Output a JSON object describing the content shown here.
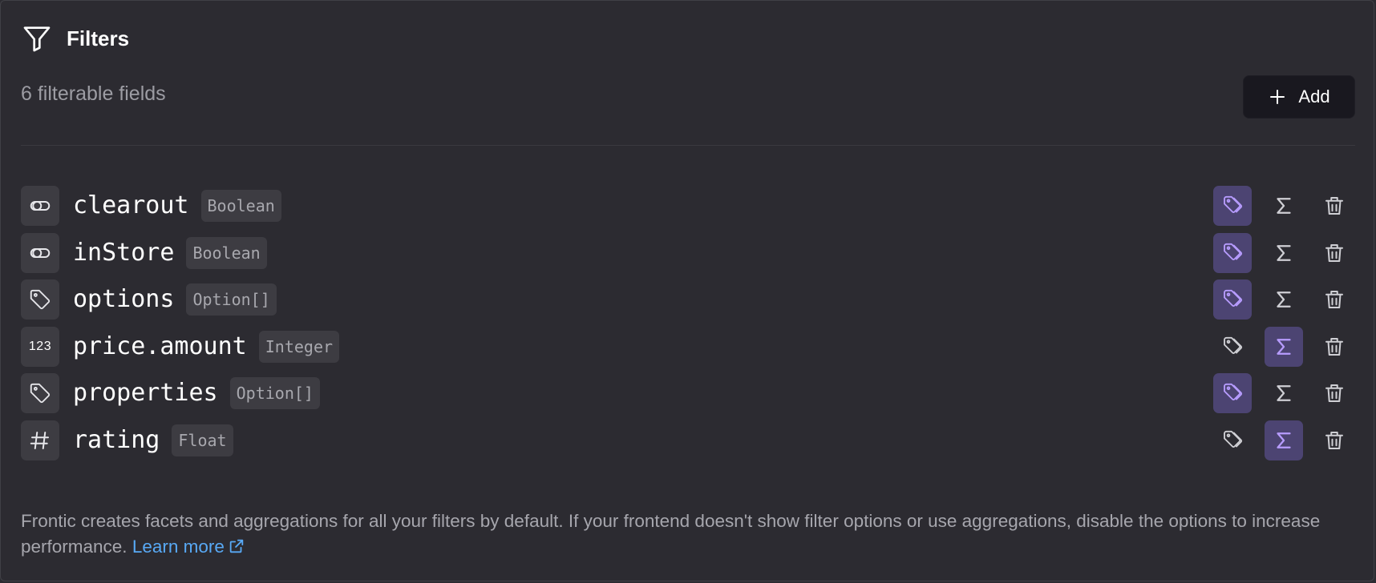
{
  "panel": {
    "title": "Filters",
    "subtitle": "6 filterable fields",
    "add_label": "Add"
  },
  "fields": [
    {
      "name": "clearout",
      "type": "Boolean",
      "icon": "toggle-icon",
      "facet": true,
      "aggregation": false
    },
    {
      "name": "inStore",
      "type": "Boolean",
      "icon": "toggle-icon",
      "facet": true,
      "aggregation": false
    },
    {
      "name": "options",
      "type": "Option[]",
      "icon": "tag-icon",
      "facet": true,
      "aggregation": false
    },
    {
      "name": "price.amount",
      "type": "Integer",
      "icon": "123",
      "facet": false,
      "aggregation": true
    },
    {
      "name": "properties",
      "type": "Option[]",
      "icon": "tag-icon",
      "facet": true,
      "aggregation": false
    },
    {
      "name": "rating",
      "type": "Float",
      "icon": "hash-icon",
      "facet": false,
      "aggregation": true
    }
  ],
  "footer": {
    "text": "Frontic creates facets and aggregations for all your filters by default. If your frontend doesn't show filter options or use aggregations, disable the options to increase performance.",
    "link_label": "Learn more"
  },
  "colors": {
    "background": "#2c2b31",
    "active_bg": "#4c4472",
    "active_icon": "#b79cff",
    "link": "#58a9f5"
  }
}
